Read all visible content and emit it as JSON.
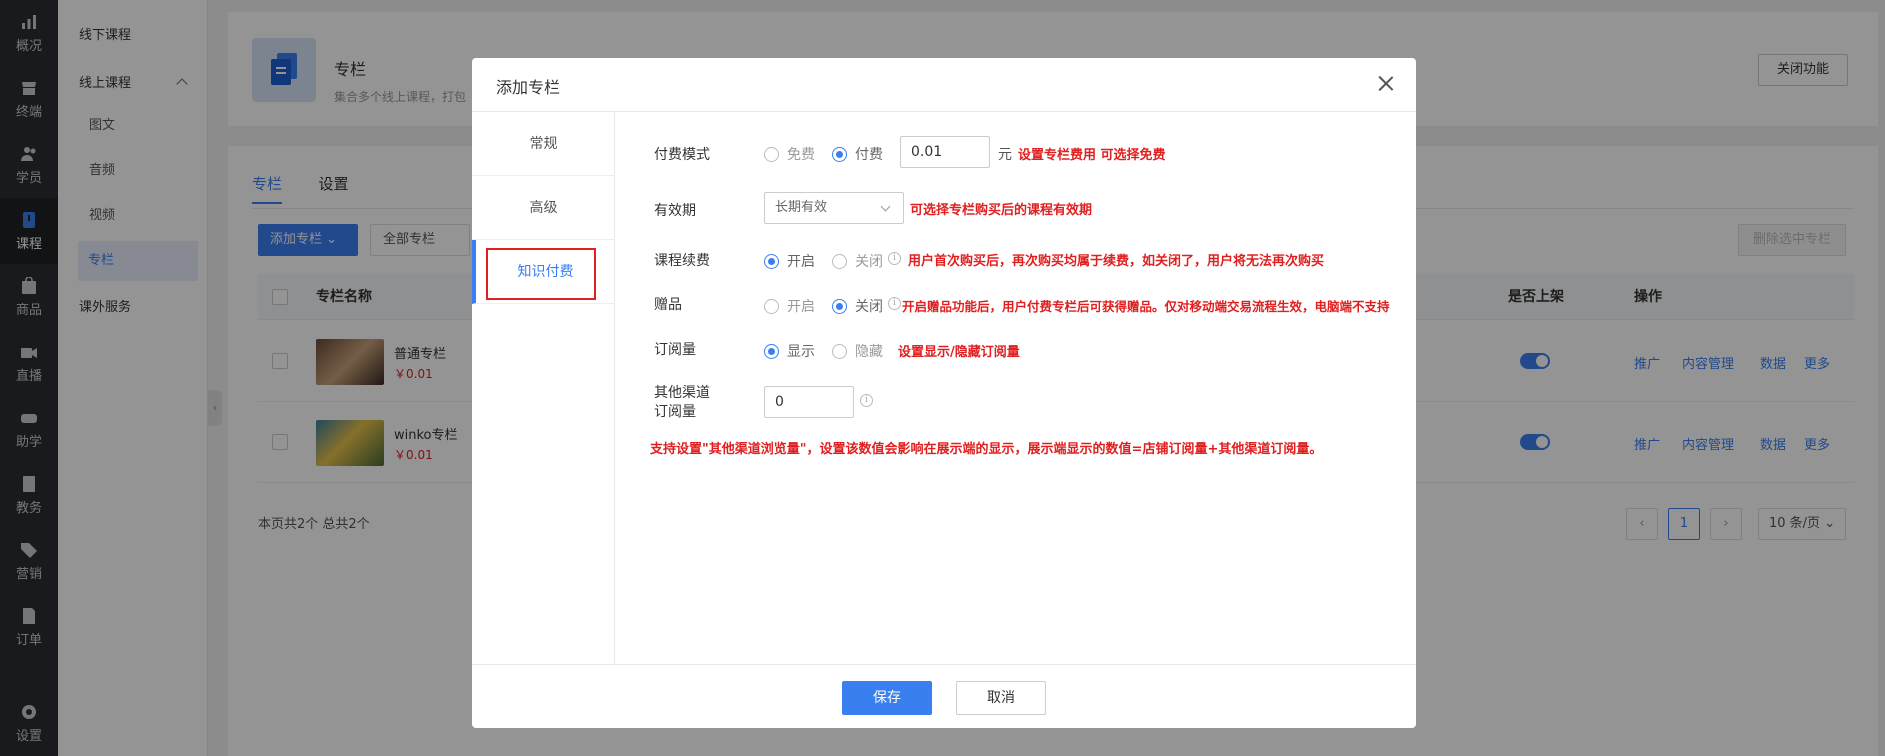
{
  "nav": {
    "items": [
      {
        "label": "概况",
        "icon": "chart-icon"
      },
      {
        "label": "终端",
        "icon": "store-icon"
      },
      {
        "label": "学员",
        "icon": "users-icon"
      },
      {
        "label": "课程",
        "icon": "course-icon"
      },
      {
        "label": "商品",
        "icon": "bag-icon"
      },
      {
        "label": "直播",
        "icon": "camera-icon"
      },
      {
        "label": "助学",
        "icon": "gamepad-icon"
      },
      {
        "label": "教务",
        "icon": "book-icon"
      },
      {
        "label": "营销",
        "icon": "tag-icon"
      },
      {
        "label": "订单",
        "icon": "document-icon"
      },
      {
        "label": "设置",
        "icon": "gear-icon"
      }
    ]
  },
  "subnav": {
    "offline": "线下课程",
    "online": "线上课程",
    "items": [
      "图文",
      "音频",
      "视频",
      "专栏"
    ],
    "extra": "课外服务"
  },
  "header": {
    "title": "专栏",
    "desc": "集合多个线上课程，打包",
    "close_btn": "关闭功能"
  },
  "list": {
    "tabs": [
      "专栏",
      "设置"
    ],
    "add_btn": "添加专栏",
    "filter": "全部专栏",
    "delete_btn": "删除选中专栏",
    "columns": {
      "name": "专栏名称",
      "onshelf": "是否上架",
      "ops": "操作"
    },
    "rows": [
      {
        "name": "普通专栏",
        "price": "￥0.01"
      },
      {
        "name": "winko专栏",
        "price": "￥0.01"
      }
    ],
    "ops": [
      "推广",
      "内容管理",
      "数据",
      "更多"
    ],
    "footer": "本页共2个 总共2个",
    "page": "1",
    "page_size": "10 条/页"
  },
  "modal": {
    "title": "添加专栏",
    "tabs": [
      "常规",
      "高级",
      "知识付费"
    ],
    "pay_mode": {
      "label": "付费模式",
      "opt_free": "免费",
      "opt_paid": "付费",
      "value": "0.01",
      "unit": "元",
      "note": "设置专栏费用 可选择免费"
    },
    "validity": {
      "label": "有效期",
      "value": "长期有效",
      "note": "可选择专栏购买后的课程有效期"
    },
    "renew": {
      "label": "课程续费",
      "opt_on": "开启",
      "opt_off": "关闭",
      "note": "用户首次购买后，再次购买均属于续费，如关闭了，用户将无法再次购买"
    },
    "gift": {
      "label": "赠品",
      "opt_on": "开启",
      "opt_off": "关闭",
      "note": "开启赠品功能后，用户付费专栏后可获得赠品。仅对移动端交易流程生效，电脑端不支持"
    },
    "subs": {
      "label": "订阅量",
      "opt_show": "显示",
      "opt_hide": "隐藏",
      "note": "设置显示/隐藏订阅量"
    },
    "other": {
      "label_1": "其他渠道",
      "label_2": "订阅量",
      "value": "0",
      "note": "支持设置\"其他渠道浏览量\"，设置该数值会影响在展示端的显示，展示端显示的数值=店铺订阅量+其他渠道订阅量。"
    },
    "save": "保存",
    "cancel": "取消"
  }
}
